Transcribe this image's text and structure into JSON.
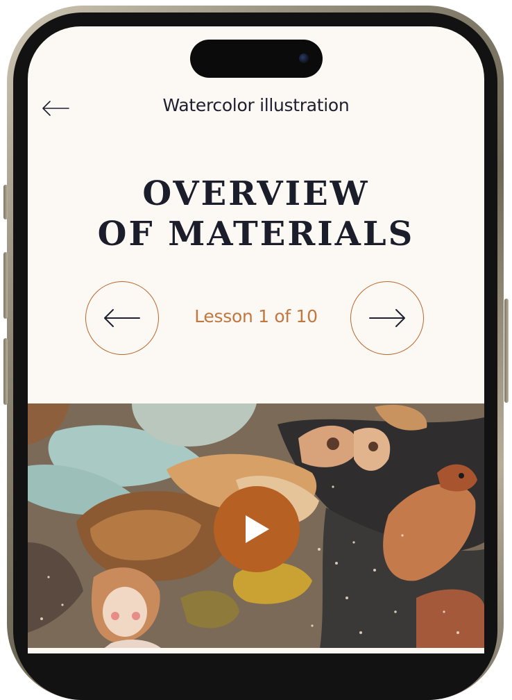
{
  "header": {
    "back_icon": "arrow-left-icon",
    "title": "Watercolor illustration"
  },
  "lesson": {
    "title_line1": "OVERVIEW",
    "title_line2": "OF MATERIALS",
    "counter": "Lesson 1 of 10",
    "prev_icon": "arrow-left-icon",
    "next_icon": "arrow-right-icon"
  },
  "video": {
    "play_icon": "play-icon"
  },
  "colors": {
    "background": "#fcf9f4",
    "accent": "#b66023",
    "text": "#1b1d2a"
  }
}
